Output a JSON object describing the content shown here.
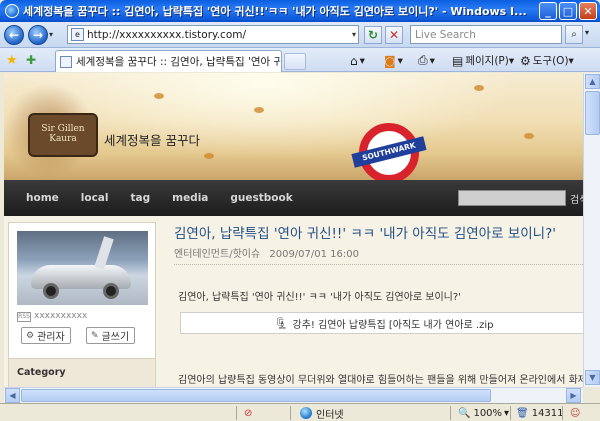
{
  "window": {
    "title": "세계정복을 꿈꾸다 :: 김연아, 납략특집 '연아 귀신!!'ㅋㅋ '내가 아직도 김연아로 보이니?' - Windows I..."
  },
  "address": {
    "url": "http://xxxxxxxxxx.tistory.com/",
    "search_placeholder": "Live Search"
  },
  "tabs": [
    {
      "label": "세계정복을 꿈꾸다 :: 김연아, 납략특집 '연아 귀..."
    }
  ],
  "commands": {
    "page": "페이지(P)",
    "tools": "도구(O)"
  },
  "blog": {
    "logo_text": "Sir Gillen Kaura",
    "title": "세계정복을 꿈꾸다",
    "sign_text": "SOUTHWARK",
    "nav": [
      "home",
      "local",
      "tag",
      "media",
      "guestbook"
    ],
    "search_label": "검색"
  },
  "sidebar": {
    "profile_name": "xxxxxxxxxx",
    "rss_badge": "RSS",
    "admin_button": "관리자",
    "write_button": "글쓰기",
    "category_title": "Category"
  },
  "post": {
    "title": "김연아, 납략특집 '연아 귀신!!' ㅋㅋ '내가 아직도 김연아로 보이니?'",
    "category": "엔터테인먼트/핫이슈",
    "date": "2009/07/01 16:00",
    "intro": "김연아, 납략특집 '연아 귀신!!' ㅋㅋ '내가 아직도 김연아로 보이니?'",
    "attachment": "강추! 김연아 납량특집 [아직도 내가 연아로 .zip",
    "body": "김연아의 납량특집 동영상이 무더위와 열대야로 힘들어하는 팬들을 위해 만들어져 온라인에서 화제"
  },
  "status": {
    "zone": "인터넷",
    "zoom": "100%",
    "count": "14311"
  }
}
